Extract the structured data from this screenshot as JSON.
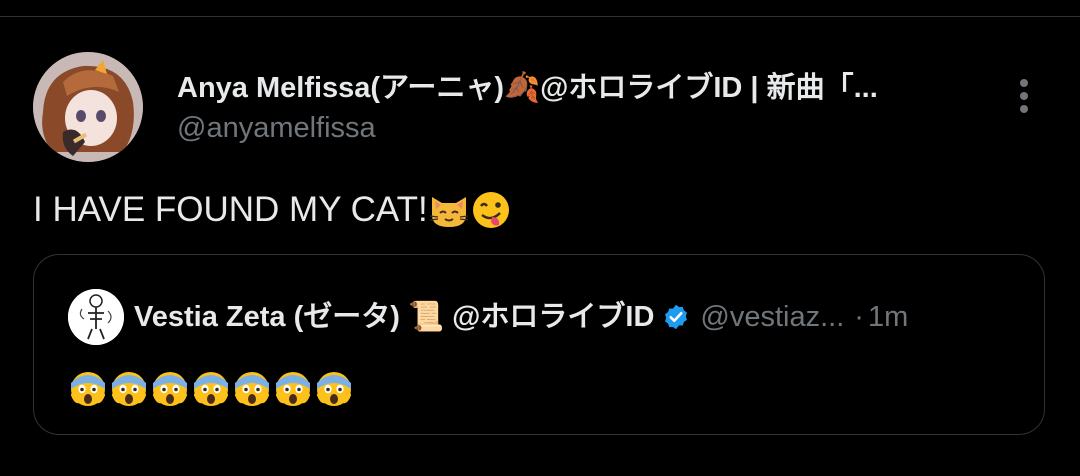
{
  "tweet": {
    "author_name": "Anya Melfissa(アーニャ)🍂@ホロライブID | 新曲「...",
    "author_handle": "@anyamelfissa",
    "text": "I HAVE FOUND MY CAT!",
    "text_emojis": [
      "cat-face-icon",
      "savoring-face-icon"
    ],
    "more_icon": "more-vertical-icon"
  },
  "quoted_tweet": {
    "author_name": "Vestia Zeta (ゼータ) 📜 @ホロライブID",
    "verified": true,
    "verified_color": "#1d9bf0",
    "author_handle": "@vestiaz...",
    "separator": "·",
    "time": "1m",
    "emoji_count": 7,
    "emoji": "screaming-face-icon"
  },
  "colors": {
    "background": "#000000",
    "primary_text": "#e7e9ea",
    "secondary_text": "#71767b",
    "border": "#2f3336"
  }
}
